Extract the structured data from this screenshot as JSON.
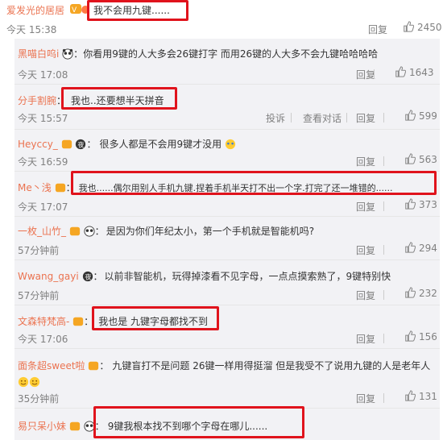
{
  "top": {
    "username": "爱发光的居居",
    "text": "我不会用九键......",
    "time": "今天 15:38",
    "reply": "回复",
    "likes": "2450"
  },
  "comments": [
    {
      "username": "黑喵白呜i",
      "text": "你看用9键的人大多会26键打字 而用26键的人大多不会九键哈哈哈哈",
      "time": "今天 17:08",
      "reply": "回复",
      "likes": "1643"
    },
    {
      "username": "分手割腕",
      "text": "我也..还要想半天拼音",
      "time": "今天 15:57",
      "report": "投诉",
      "view_conv": "查看对话",
      "reply": "回复",
      "likes": "599"
    },
    {
      "username": "Heyccy_",
      "text": "很多人都是不会用9键才没用",
      "time": "今天 16:59",
      "reply": "回复",
      "likes": "563"
    },
    {
      "username": "Me丶浅",
      "text": "我也......偶尔用别人手机九键.捏着手机半天打不出一个字.打完了还一堆错的......",
      "time": "今天 17:07",
      "reply": "回复",
      "likes": "373"
    },
    {
      "username": "一枚_山竹_",
      "text": "是因为你们年纪太小，第一个手机就是智能机吗?",
      "time": "57分钟前",
      "reply": "回复",
      "likes": "294"
    },
    {
      "username": "Wwang_gayi",
      "text": "以前非智能机，玩得掉漆看不见字母，一点点摸索熟了，9键特别快",
      "time": "57分钟前",
      "reply": "回复",
      "likes": "232"
    },
    {
      "username": "文森特梵高-",
      "text": "我也是 九键字母都找不到",
      "time": "今天 17:06",
      "reply": "回复",
      "likes": "156"
    },
    {
      "username": "面条超sweet啦",
      "text": "九键盲打不是问题 26键一样用得挺溜 但是我受不了说用九键的人是老年人",
      "time": "35分钟前",
      "reply": "回复",
      "likes": "131"
    },
    {
      "username": "易只呆小妹",
      "text": "9键我根本找不到哪个字母在哪儿......",
      "time": "",
      "reply": "",
      "likes": ""
    }
  ],
  "colors": {
    "username": "#eb7350",
    "highlight": "#e0131c",
    "meta": "#808080"
  },
  "icons": [
    "thumb-up-icon",
    "vip-badge-icon",
    "panda-icon",
    "night-icon",
    "smile-emoji"
  ]
}
